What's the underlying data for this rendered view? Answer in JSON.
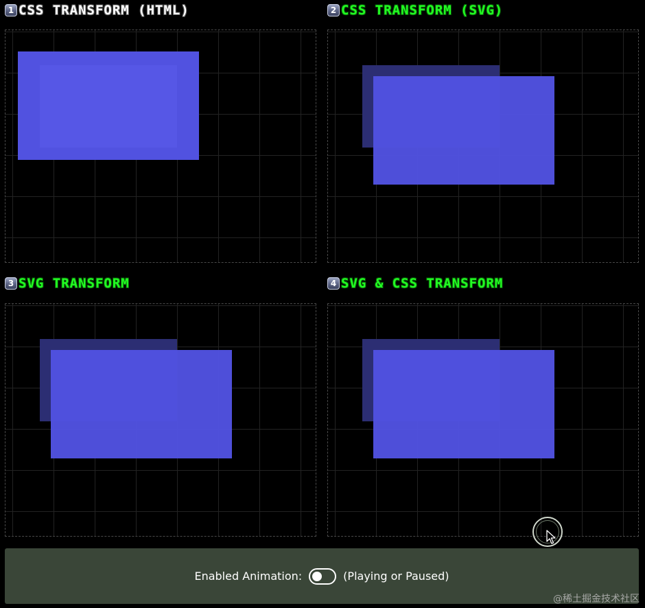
{
  "panels": [
    {
      "number": "1",
      "title": "CSS TRANSFORM (HTML)",
      "title_color": "#ffffff"
    },
    {
      "number": "2",
      "title": "CSS TRANSFORM (SVG)",
      "title_color": "#22ff22"
    },
    {
      "number": "3",
      "title": "SVG TRANSFORM",
      "title_color": "#22ff22"
    },
    {
      "number": "4",
      "title": "SVG & CSS TRANSFORM",
      "title_color": "#22ff22"
    }
  ],
  "controls": {
    "label": "Enabled Animation:",
    "status": "(Playing or Paused)",
    "toggle_on": false
  },
  "watermark": "@稀土掘金技术社区",
  "colors": {
    "rect_fill": "#5152e0",
    "ghost_fill": "#2c2e73",
    "grid_line": "#232323",
    "panel_border": "#4a4a4a",
    "controls_bg": "#3a4638"
  }
}
